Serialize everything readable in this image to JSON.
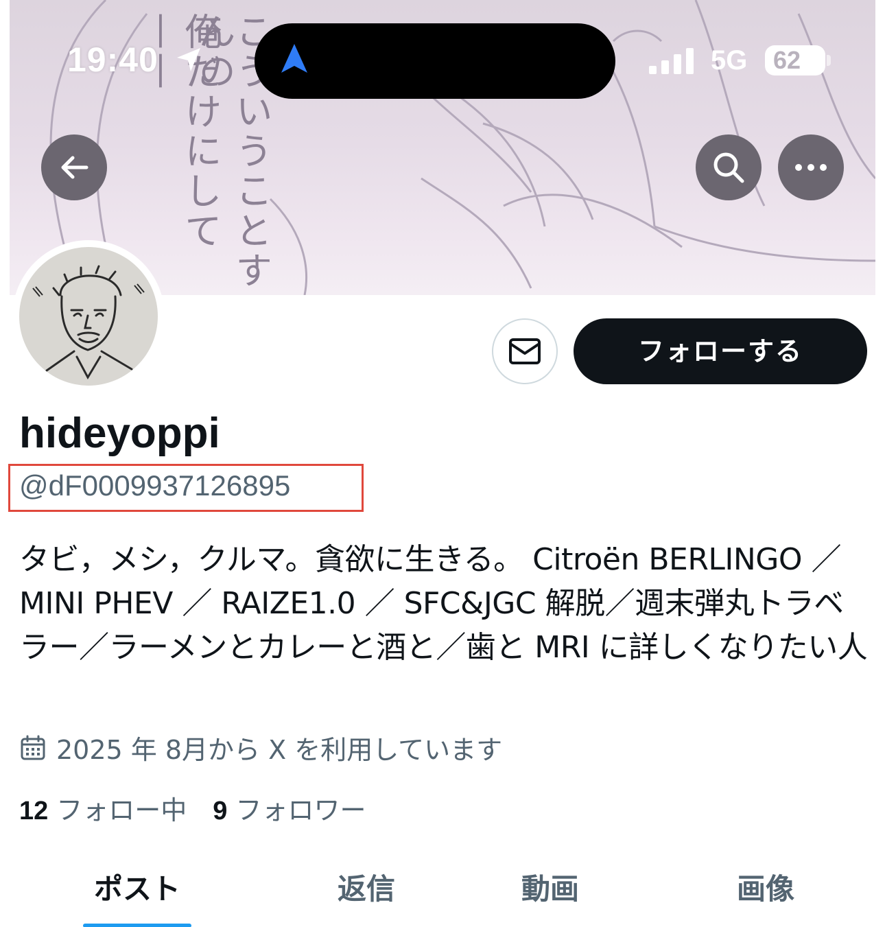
{
  "status_bar": {
    "time": "19:40",
    "network": "5G",
    "battery_level": "62",
    "icons": [
      "location-arrow-icon",
      "navigation-icon",
      "signal-bars-icon",
      "battery-icon"
    ]
  },
  "banner": {
    "text_line_1": "俺だけにして——",
    "text_line_2": "こういうことすんの"
  },
  "nav": {
    "icons": [
      "back-arrow-icon",
      "search-icon",
      "more-dots-icon"
    ]
  },
  "actions": {
    "message_icon": "envelope-icon",
    "follow_label": "フォローする"
  },
  "profile": {
    "display_name": "hideyoppi",
    "handle": "@dF0009937126895",
    "bio": "タビ，メシ，クルマ。貪欲に生きる。 Citroën BERLINGO ／MINI PHEV ／ RAIZE1.0 ／ SFC&JGC 解脱／週末弾丸トラベラー／ラーメンとカレーと酒と／歯と MRI に詳しくなりたい人",
    "joined": "2025 年 8月から X を利用しています",
    "following_count": "12",
    "following_label": "フォロー中",
    "followers_count": "9",
    "followers_label": "フォロワー"
  },
  "tabs": [
    {
      "label": "ポスト",
      "active": true
    },
    {
      "label": "返信",
      "active": false
    },
    {
      "label": "動画",
      "active": false
    },
    {
      "label": "画像",
      "active": false
    }
  ],
  "colors": {
    "accent": "#1d9bf0",
    "highlight_box": "#e0483c",
    "text_primary": "#0f1419",
    "text_secondary": "#536471",
    "nav_arrow": "#2f7cf6"
  }
}
